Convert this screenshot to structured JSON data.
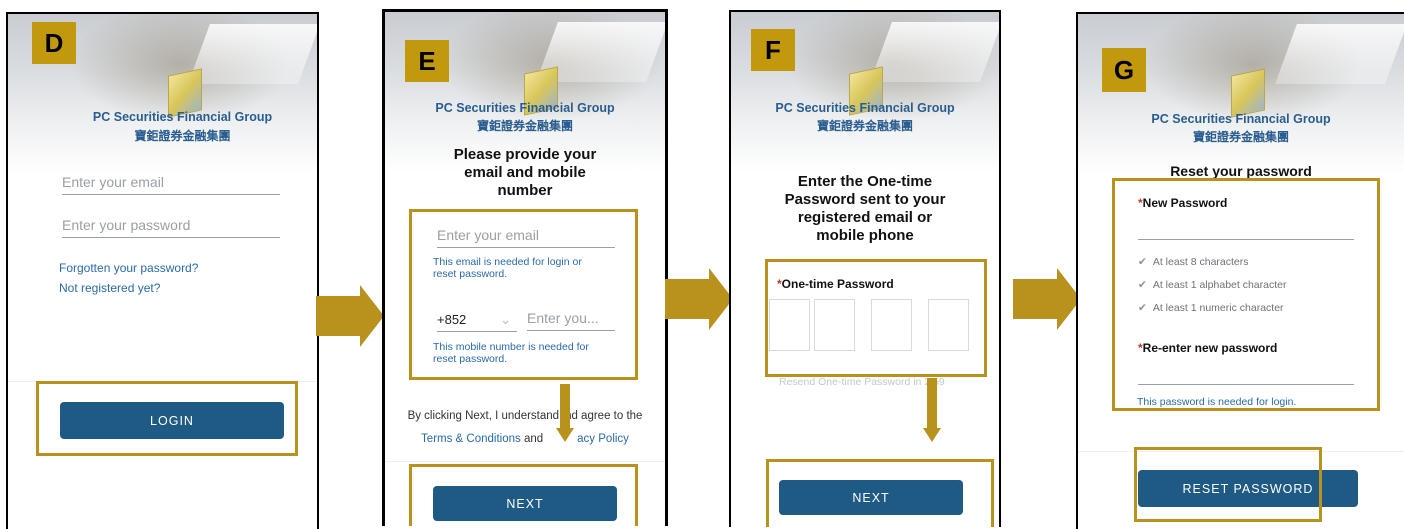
{
  "brand": {
    "name_en": "PC Securities Financial Group",
    "name_zh": "寶鉅證券金融集團"
  },
  "screens": {
    "d": {
      "tag": "D",
      "email_placeholder": "Enter your email",
      "password_placeholder": "Enter your password",
      "forgot_link": "Forgotten your password?",
      "register_link": "Not registered yet?",
      "login_button": "LOGIN"
    },
    "e": {
      "tag": "E",
      "heading_1": "Please provide your",
      "heading_2": "email and mobile",
      "heading_3": "number",
      "email_placeholder": "Enter your email",
      "email_hint_1": "This email is needed for login or",
      "email_hint_2": "reset password.",
      "country_code": "+852",
      "mobile_placeholder": "Enter you...",
      "mobile_hint_1": "This mobile number is needed for",
      "mobile_hint_2": "reset password.",
      "terms_line_1_a": "By clicking Next, I understand",
      "terms_line_1_b": "nd agree to the",
      "terms_link": "Terms & Conditions",
      "terms_and": " and",
      "privacy_link": "acy Policy",
      "next_button": "NEXT"
    },
    "f": {
      "tag": "F",
      "heading_1": "Enter the One-time",
      "heading_2": "Password sent to your",
      "heading_3": "registered email or",
      "heading_4": "mobile phone",
      "otp_label": "One-time Password",
      "resend_text": "Resend One-time Password in  2:59",
      "next_button": "NEXT"
    },
    "g": {
      "tag": "G",
      "heading": "Reset your password",
      "new_password_label": "New Password",
      "criteria": [
        "At least 8 characters",
        "At least 1 alphabet character",
        "At least 1 numeric character"
      ],
      "reenter_label": "Re-enter new password",
      "password_hint": "This password is needed for login.",
      "reset_button": "RESET PASSWORD"
    }
  },
  "colors": {
    "accent": "#b8921d",
    "button": "#1f5a84",
    "link": "#2a6aa8",
    "required": "#c0392b"
  }
}
